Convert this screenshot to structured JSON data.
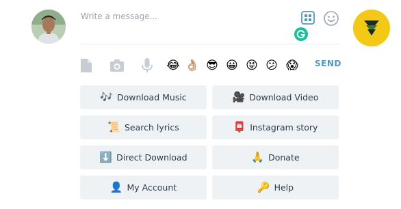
{
  "composer": {
    "placeholder": "Write a message...",
    "send_label": "SEND"
  },
  "toolbar": {
    "tools": [
      "file-icon",
      "camera-icon",
      "microphone-icon"
    ],
    "emojis": [
      "😂",
      "👌🏼",
      "😎",
      "😀",
      "😝",
      "😕",
      "😱"
    ]
  },
  "keyboard": {
    "buttons": [
      {
        "icon": "🎶",
        "label": "Download Music"
      },
      {
        "icon": "🎥",
        "label": "Download Video"
      },
      {
        "icon": "📜",
        "label": "Search lyrics"
      },
      {
        "icon": "📮",
        "label": "Instagram story"
      },
      {
        "icon": "⬇️",
        "label": "Direct Download"
      },
      {
        "icon": "🙏",
        "label": "Donate"
      },
      {
        "icon": "👤",
        "label": "My Account"
      },
      {
        "icon": "🔑",
        "label": "Help"
      }
    ]
  },
  "colors": {
    "accent": "#4f97c9",
    "fab": "#f3c915",
    "button_bg": "#eef2f5"
  }
}
